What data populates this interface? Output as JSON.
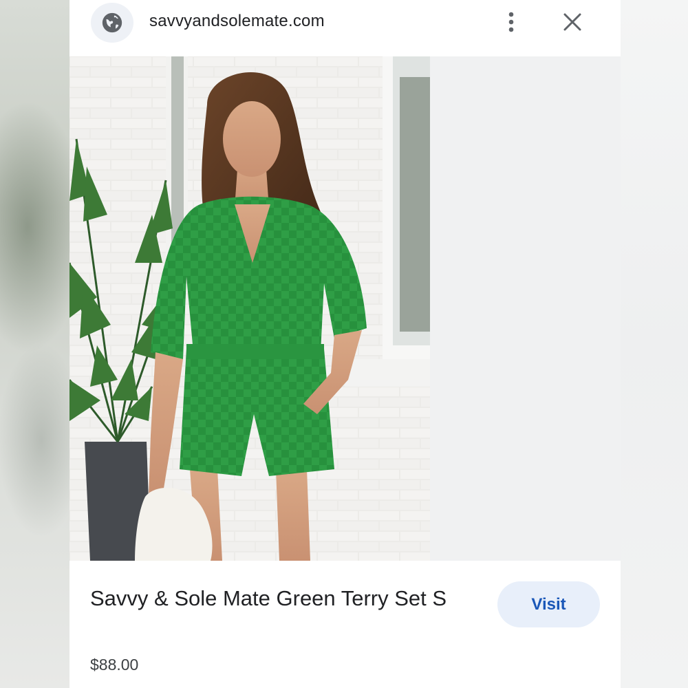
{
  "header": {
    "site_icon": "globe-icon",
    "domain": "savvyandsolemate.com",
    "more_icon": "more-vert-icon",
    "close_icon": "close-icon"
  },
  "product": {
    "title": "Savvy & Sole Mate Green Terry Set S",
    "price": "$88.00",
    "visit_label": "Visit",
    "image_description_icon": "product-photo"
  },
  "colors": {
    "accent": "#1a57b8",
    "button_bg": "#e8effa",
    "garment_green": "#2ea043"
  }
}
